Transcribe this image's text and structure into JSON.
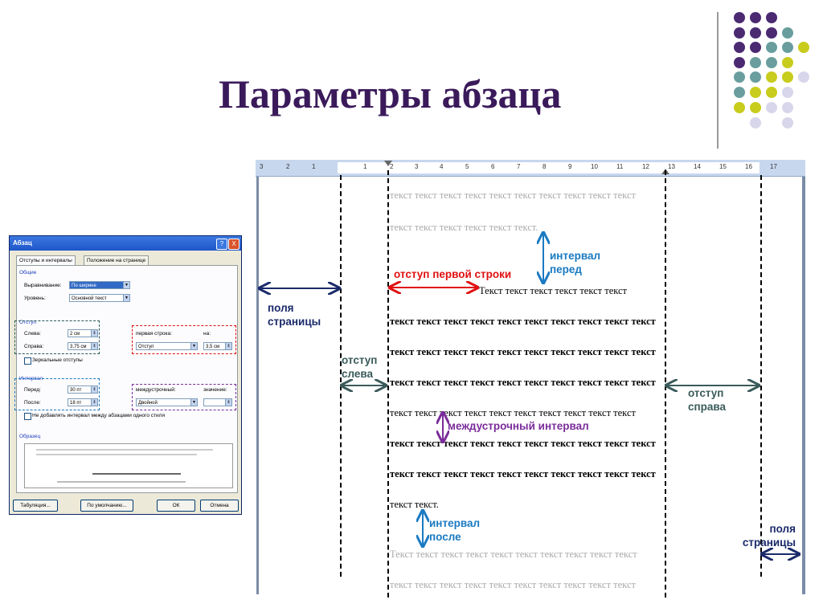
{
  "title": "Параметры абзаца",
  "colors": {
    "purple": "#4b2a72",
    "teal": "#6a9e9e",
    "olive": "#c8cc1c",
    "lavender": "#d8d6ea",
    "first_line": "#e01010",
    "spacing": "#1a7ac2",
    "line_spacing": "#7a2c9a",
    "indent": "#3a5a5a",
    "margins": "#1a2a6a"
  },
  "dialog": {
    "title": "Абзац",
    "help_icon": "?",
    "close_icon": "X",
    "tabs": [
      "Отступы и интервалы",
      "Положение на странице"
    ],
    "general_section": "Общие",
    "alignment_label": "Выравнивание:",
    "alignment_value": "По ширине",
    "level_label": "Уровень:",
    "level_value": "Основной текст",
    "indent_section": "Отступ",
    "left_label": "Слева:",
    "left_value": "2 см",
    "right_label": "Справа:",
    "right_value": "3,75 см",
    "first_line_label": "первая строка:",
    "first_line_value": "Отступ",
    "first_line_by_label": "на:",
    "first_line_by_value": "3,5 см",
    "mirror_label": "Зеркальные отступы",
    "spacing_section": "Интервал",
    "before_label": "Перед:",
    "before_value": "30 пт",
    "after_label": "После:",
    "after_value": "18 пт",
    "line_spacing_label": "междустрочный:",
    "line_spacing_value": "Двойной",
    "value_label": "значение:",
    "no_space_label": "Не добавлять интервал между абзацами одного стиля",
    "sample_section": "Образец",
    "buttons": {
      "tabs": "Табуляция...",
      "default": "По умолчанию...",
      "ok": "ОК",
      "cancel": "Отмена"
    }
  },
  "ruler": [
    "3",
    "2",
    "1",
    "1",
    "2",
    "3",
    "4",
    "5",
    "6",
    "7",
    "8",
    "9",
    "10",
    "11",
    "12",
    "13",
    "14",
    "15",
    "16",
    "17"
  ],
  "text": {
    "gray_row": "текст текст текст текст текст текст текст текст текст текст",
    "gray_short": "текст текст текст текст текст текст.",
    "first_row": "Текст текст текст текст текст текст",
    "black_row": "текст текст текст текст текст текст текст текст текст текст",
    "end_row": "текст текст.",
    "gray_after": "Текст текст текст текст текст текст текст текст текст текст"
  },
  "labels": {
    "before": [
      "интервал",
      "перед"
    ],
    "first_line": "отступ первой строки",
    "page_margin": [
      "поля",
      "страницы"
    ],
    "left_indent": [
      "отступ",
      "слева"
    ],
    "right_indent": [
      "отступ",
      "справа"
    ],
    "line_spacing": "междустрочный интервал",
    "after": [
      "интервал",
      "после"
    ],
    "page_margin_right": [
      "поля",
      "страницы"
    ]
  }
}
